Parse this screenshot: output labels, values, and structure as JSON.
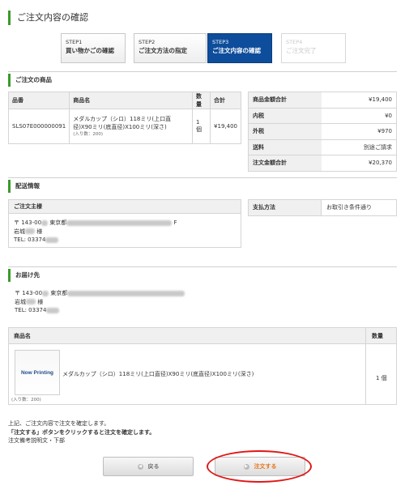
{
  "page": {
    "title": "ご注文内容の確認"
  },
  "steps": [
    {
      "num": "STEP1",
      "label": "買い物かごの確認"
    },
    {
      "num": "STEP2",
      "label": "ご注文方法の指定"
    },
    {
      "num": "STEP3",
      "label": "ご注文内容の確認"
    },
    {
      "num": "STEP4",
      "label": "ご注文完了"
    }
  ],
  "products": {
    "heading": "ご注文の商品",
    "headers": {
      "code": "品番",
      "name": "商品名",
      "qty": "数量",
      "total": "合計"
    },
    "rows": [
      {
        "code": "SLS07E000000091",
        "name": "メダルカップ（シロ）118ミリ(上口直径)X90ミリ(底直径)X100ミリ(深さ)",
        "inner": "(入り数：200)",
        "qty": "1 個",
        "total": "¥19,400"
      }
    ]
  },
  "summary": [
    {
      "label": "商品金額合計",
      "value": "¥19,400"
    },
    {
      "label": "内税",
      "value": "¥0"
    },
    {
      "label": "外税",
      "value": "¥970"
    },
    {
      "label": "送料",
      "value": "別途ご請求"
    },
    {
      "label": "注文金額合計",
      "value": "¥20,370"
    }
  ],
  "delivery": {
    "heading": "配送情報",
    "orderer_label": "ご注文主様",
    "orderer": {
      "postal": "〒 143-00",
      "pref": "東京都",
      "suffix": "F",
      "name": "岩城",
      "honorific": "様",
      "tel": "TEL: 03374"
    },
    "payment_label": "支払方法",
    "payment_value": "お取引き条件通り"
  },
  "shipto": {
    "heading": "お届け先",
    "postal": "〒 143-00",
    "pref": "東京都",
    "name": "岩城",
    "honorific": "様",
    "tel": "TEL: 03374"
  },
  "items2": {
    "header_name": "商品名",
    "header_qty": "数量",
    "thumb_logo": "Now Printing",
    "name": "メダルカップ（シロ）118ミリ(上口直径)X90ミリ(底直径)X100ミリ(深さ)",
    "inner": "(入り数：200)",
    "qty": "1 個"
  },
  "notes": {
    "line1": "上記、ご注文内容で注文を確定します。",
    "line2": "「注文する」ボタンをクリックすると注文を確定します。",
    "line3": "注文備考説明文・下部"
  },
  "buttons": {
    "back": "戻る",
    "order": "注文する"
  },
  "colors": {
    "accent_green": "#3a9a2a",
    "active_step": "#0d4d9b",
    "step_arrow": "#f08c1c",
    "order_text": "#e8731a",
    "highlight_circle": "#e01818"
  }
}
